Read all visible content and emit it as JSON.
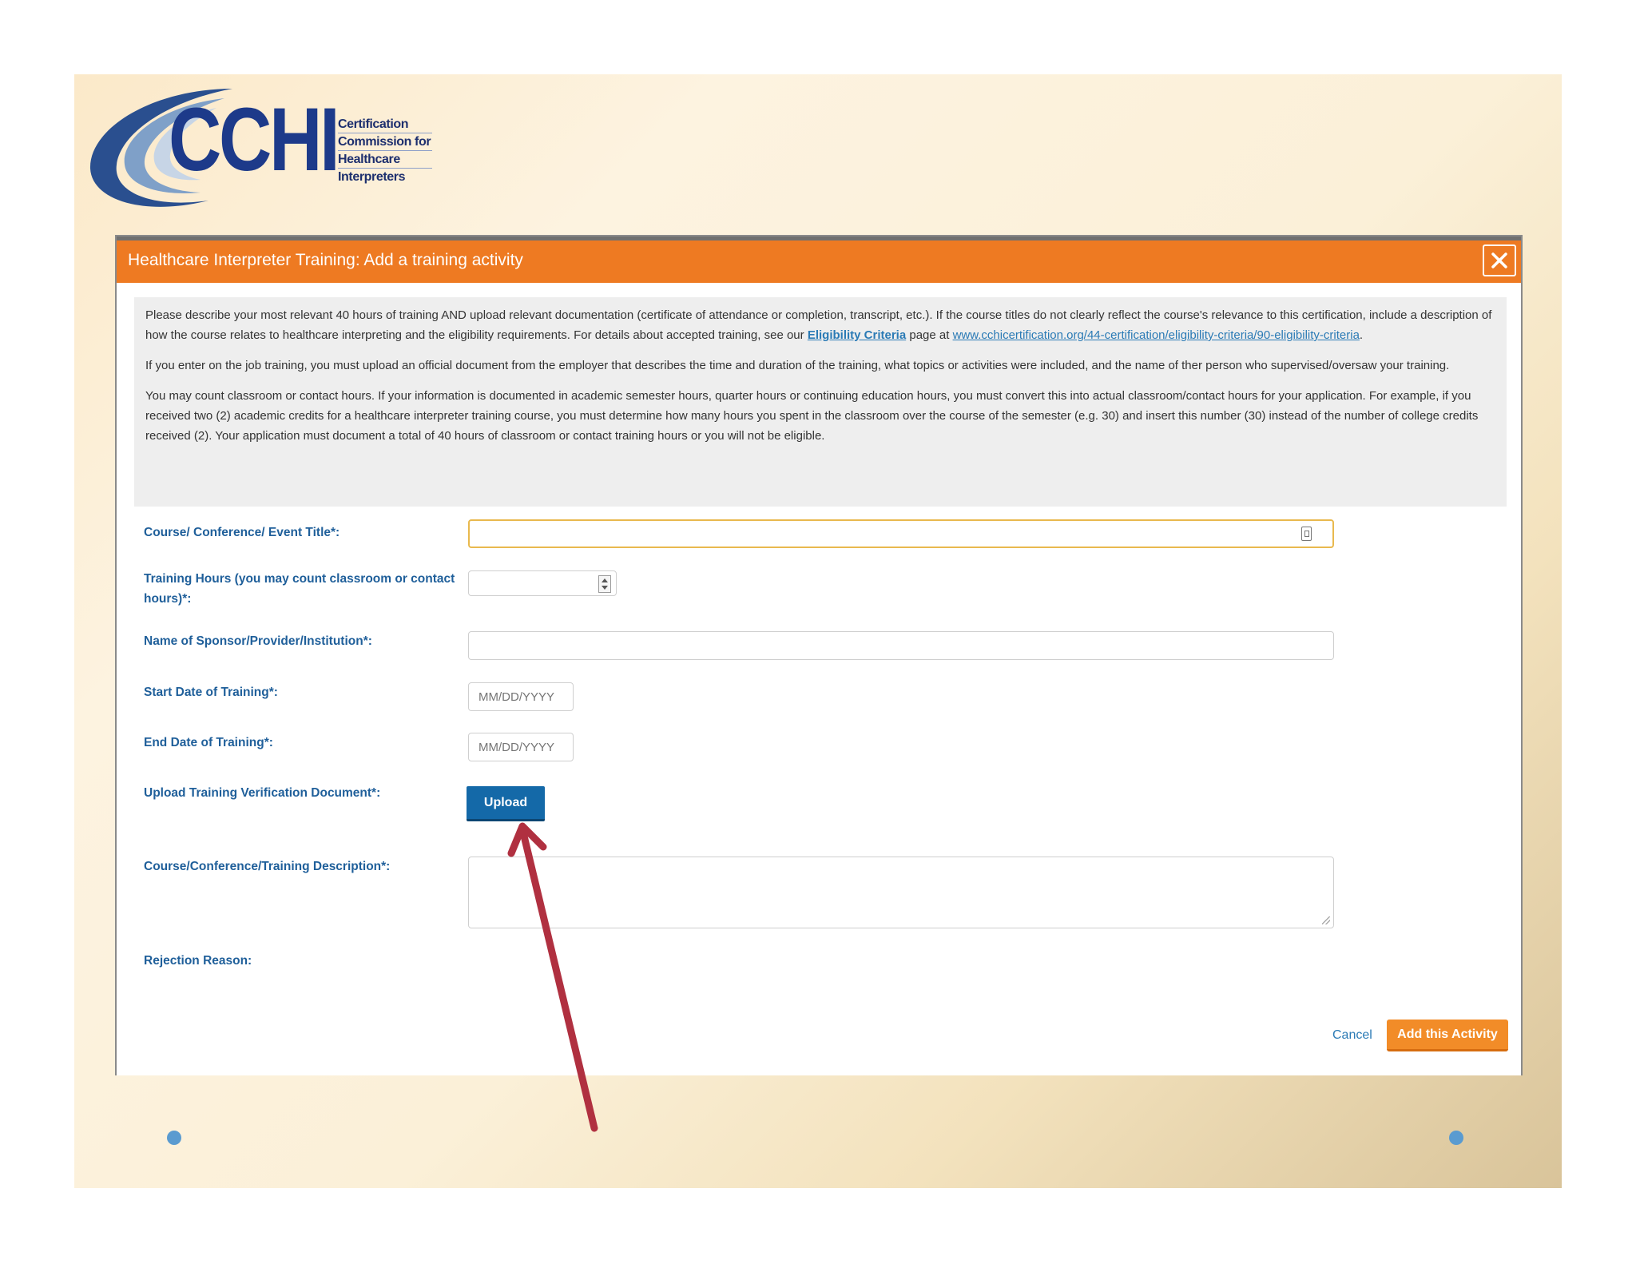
{
  "logo": {
    "word": "CCHI",
    "tagline": [
      "Certification",
      "Commission for",
      "Healthcare",
      "Interpreters"
    ]
  },
  "modal": {
    "title": "Healthcare Interpreter Training: Add a training activity",
    "close_icon": "close-icon",
    "info": {
      "p1_before": "Please describe your most relevant 40 hours of training AND upload relevant documentation (certificate of attendance or completion, transcript, etc.). If the course titles do not clearly reflect the course's relevance to this certification, include a  description of how the course relates to healthcare interpreting and the eligibility requirements. For details about accepted training, see our ",
      "p1_link1": "Eligibility Criteria",
      "p1_middle": " page at ",
      "p1_link2": "www.cchicertification.org/44-certification/eligibility-criteria/90-eligibility-criteria",
      "p1_after": ".",
      "p2": "If you enter on the job training, you must upload an official document from the employer that describes the time and duration of the training, what topics or activities were included, and the name of ther person who supervised/oversaw your training.",
      "p3": "You may count classroom or contact hours. If your information is documented in academic semester hours, quarter hours or continuing education hours, you must convert this into actual classroom/contact hours for your application. For example, if you received two (2) academic credits for a healthcare interpreter training course, you must determine how many hours you spent in the classroom over the course of the semester (e.g. 30) and insert this number (30) instead of the number of college credits received (2). Your application must document a total of 40 hours of classroom or contact training hours or you will not be eligible."
    },
    "form": {
      "course_title_label": "Course/ Conference/ Event Title*:",
      "course_title_value": "",
      "hours_label": "Training Hours (you may count classroom or contact hours)*:",
      "hours_value": "",
      "sponsor_label": "Name of Sponsor/Provider/Institution*:",
      "sponsor_value": "",
      "start_label": "Start Date of Training*:",
      "start_placeholder": "MM/DD/YYYY",
      "end_label": "End Date of Training*:",
      "end_placeholder": "MM/DD/YYYY",
      "upload_label": "Upload Training Verification Document*:",
      "upload_button": "Upload",
      "description_label": "Course/Conference/Training Description*:",
      "description_value": "",
      "rejection_label": "Rejection Reason:"
    },
    "footer": {
      "cancel": "Cancel",
      "add": "Add this Activity"
    }
  },
  "colors": {
    "header": "#ee7a22",
    "label": "#1f5f9a",
    "upload": "#1469a8",
    "add": "#f28c28",
    "arrow": "#b03040"
  }
}
